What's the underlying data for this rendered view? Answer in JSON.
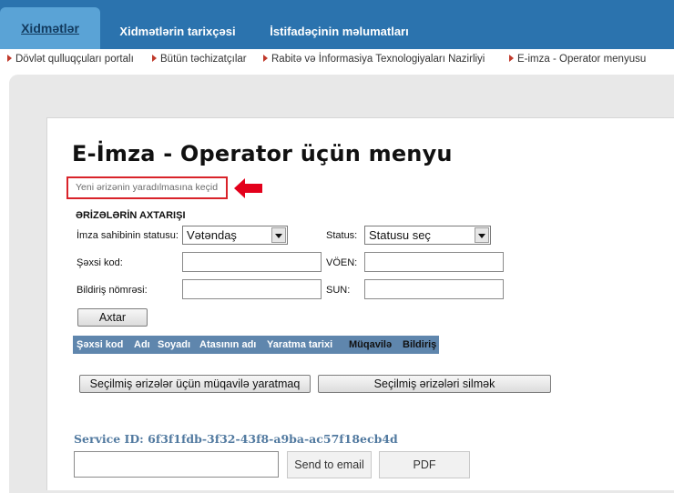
{
  "nav": {
    "tabs": [
      {
        "label": "Xidmətlər",
        "active": true
      },
      {
        "label": "Xidmətlərin tarixçəsi"
      },
      {
        "label": "İstifadəçinin məlumatları"
      }
    ]
  },
  "breadcrumbs": [
    "Dövlət qulluqçuları portalı",
    "Bütün təchizatçılar",
    "Rabitə və İnformasiya Texnologiyaları Nazirliyi",
    "E-imza - Operator menyusu"
  ],
  "page": {
    "title": "E-İmza - Operator üçün menyu",
    "new_request_link": "Yeni ərizənin yaradılmasına keçid"
  },
  "search": {
    "title": "ƏRİZƏLƏRİN AXTARIŞI",
    "owner_status_label": "İmza sahibinin statusu:",
    "owner_status_value": "Vətəndaş",
    "status_label": "Status:",
    "status_value": "Statusu seç",
    "personal_code_label": "Şəxsi kod:",
    "personal_code_value": "",
    "voen_label": "VÖEN:",
    "voen_value": "",
    "notice_number_label": "Bildiriş nömrəsi:",
    "notice_number_value": "",
    "sun_label": "SUN:",
    "sun_value": "",
    "search_button": "Axtar"
  },
  "grid": {
    "columns": [
      "Şəxsi kod",
      "Adı",
      "Soyadı",
      "Atasının adı",
      "Yaratma tarixi",
      "Müqavilə",
      "Bildiriş"
    ]
  },
  "actions": {
    "create_contract": "Seçilmiş ərizələr üçün müqavilə yaratmaq",
    "delete_selected": "Seçilmiş ərizələri silmək"
  },
  "service": {
    "label": "Service ID: 6f3f1fdb-3f32-43f8-a9ba-ac57f18ecb4d",
    "email_value": "",
    "send_email_button": "Send to email",
    "pdf_button": "PDF"
  },
  "colors": {
    "nav_bg": "#2b73ae",
    "active_tab": "#5aa3d6",
    "grid_header": "#5f86ad",
    "highlight_red": "#d9232a"
  }
}
